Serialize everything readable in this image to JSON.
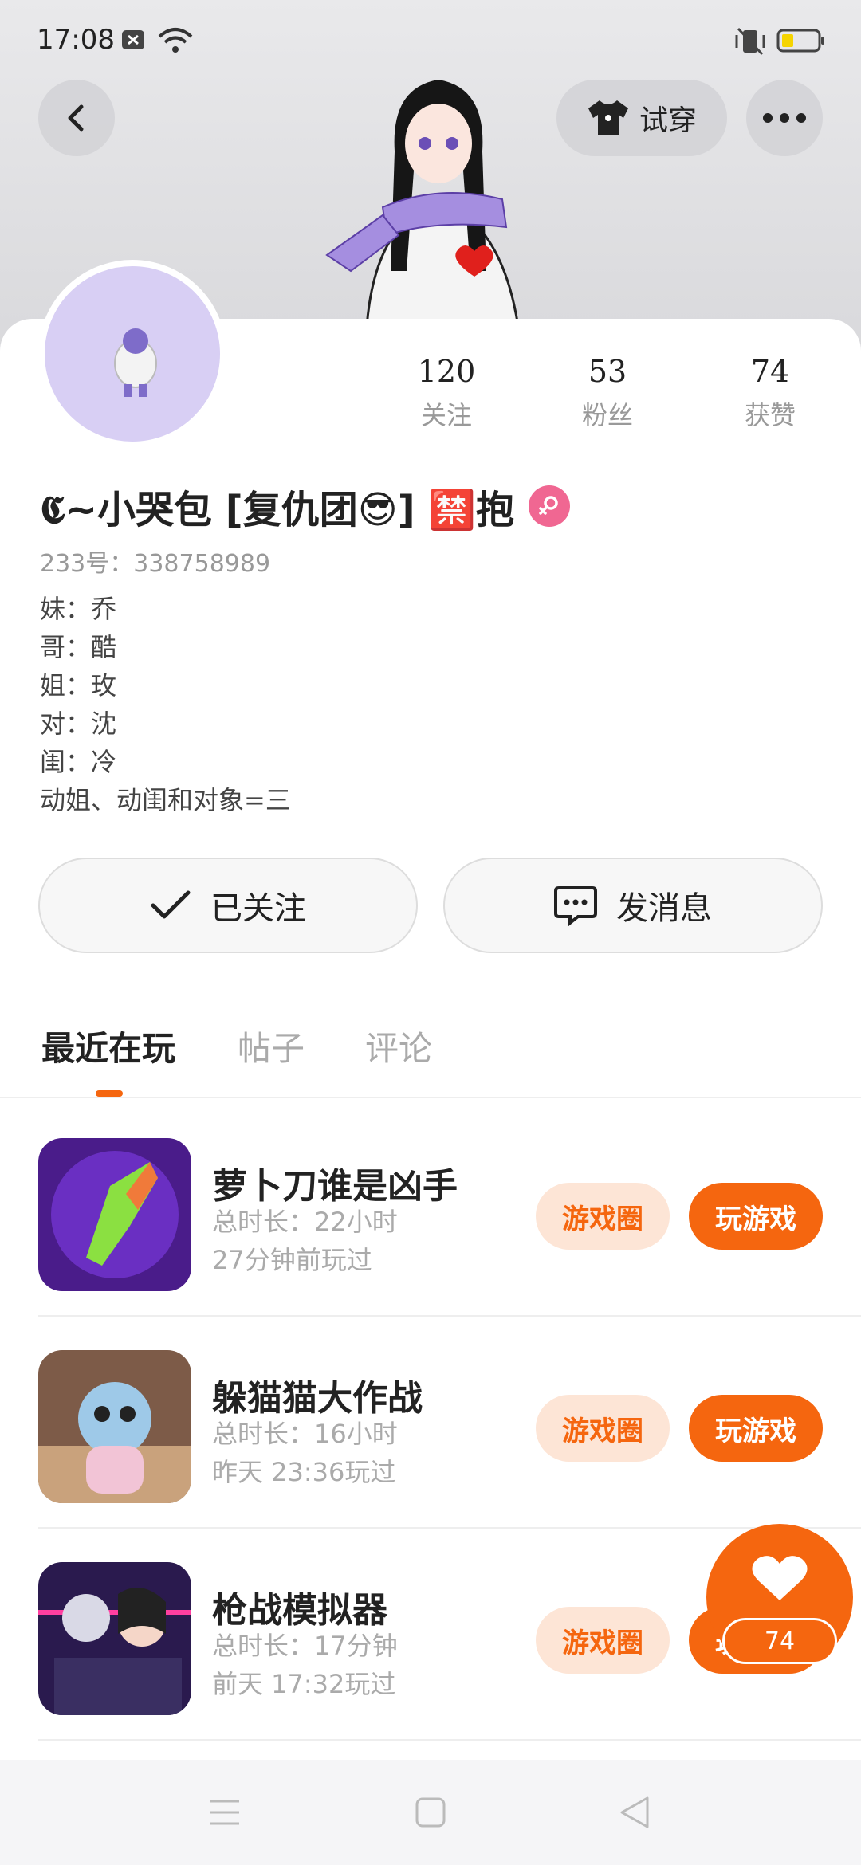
{
  "status_bar": {
    "time": "17:08",
    "battery_color": "#f5d400"
  },
  "header": {
    "try_on_label": "试穿"
  },
  "profile": {
    "stats": [
      {
        "value": "120",
        "label": "关注"
      },
      {
        "value": "53",
        "label": "粉丝"
      },
      {
        "value": "74",
        "label": "获赞"
      }
    ],
    "name": "𝕮~小哭包 [复仇团😎] 🈲抱",
    "uid": "233号：338758989",
    "bio": [
      "妹：乔",
      "哥：酷",
      "姐：玫",
      "对：沈",
      "闺：冷",
      "动姐、动闺和对象=三"
    ]
  },
  "actions": {
    "followed_label": "已关注",
    "message_label": "发消息"
  },
  "tabs": [
    {
      "label": "最近在玩",
      "active": true
    },
    {
      "label": "帖子",
      "active": false
    },
    {
      "label": "评论",
      "active": false
    }
  ],
  "games": [
    {
      "title": "萝卜刀谁是凶手",
      "playtime": "总时长：22小时",
      "last_played": "27分钟前玩过",
      "circle_label": "游戏圈",
      "play_label": "玩游戏"
    },
    {
      "title": "躲猫猫大作战",
      "playtime": "总时长：16小时",
      "last_played": "昨天 23:36玩过",
      "circle_label": "游戏圈",
      "play_label": "玩游戏"
    },
    {
      "title": "枪战模拟器",
      "playtime": "总时长：17分钟",
      "last_played": "前天 17:32玩过",
      "circle_label": "游戏圈",
      "play_label": "玩游戏"
    }
  ],
  "like_fab": {
    "count": "74"
  },
  "colors": {
    "accent": "#f5660f",
    "accent_light": "#fde5d6",
    "gender": "#f06792"
  }
}
